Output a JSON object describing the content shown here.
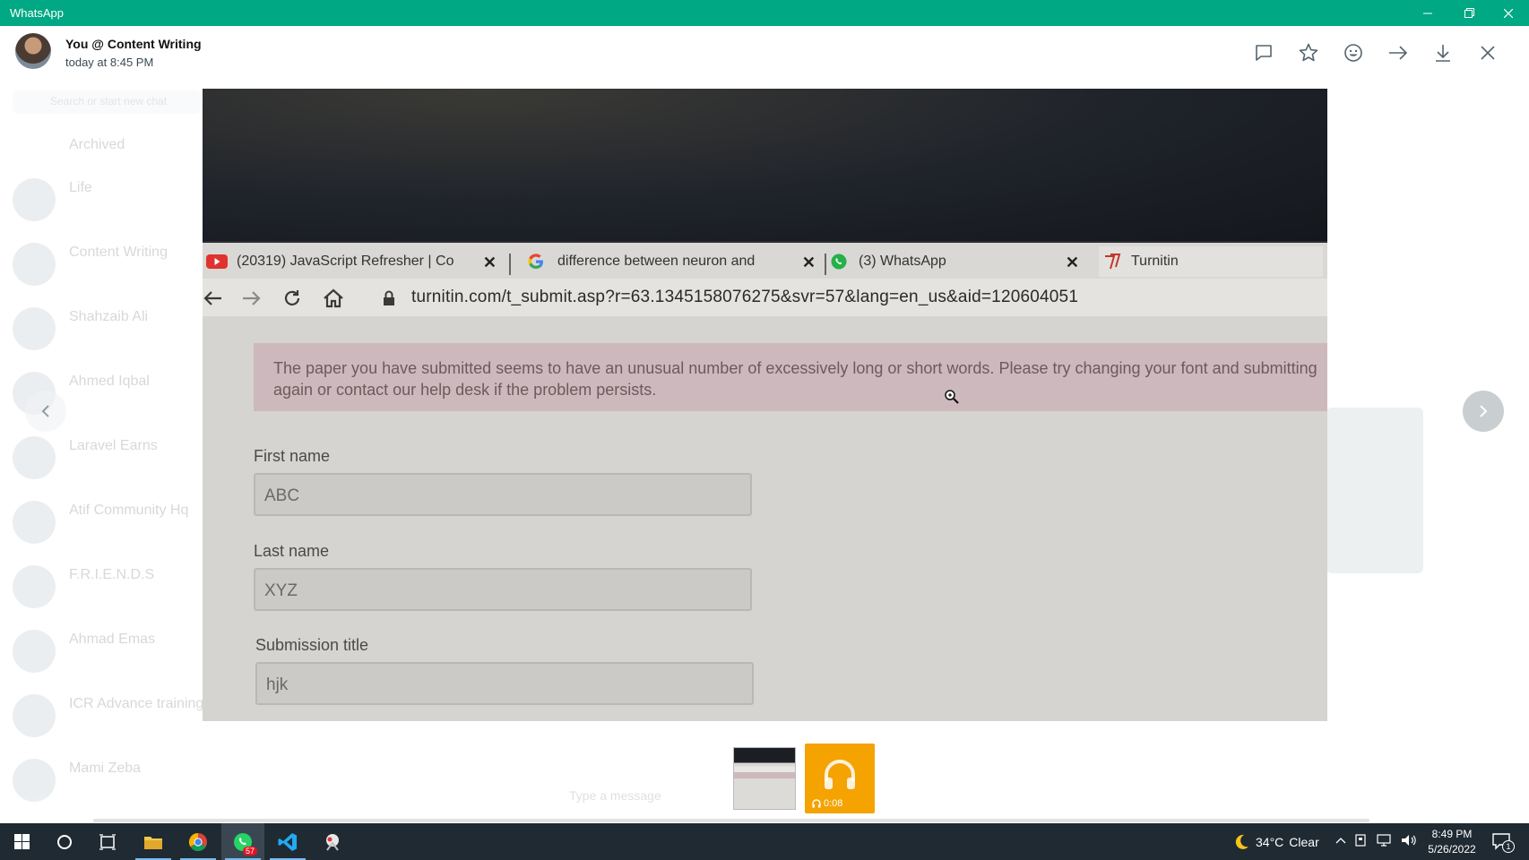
{
  "window": {
    "title": "WhatsApp"
  },
  "viewer": {
    "sender": "You @ Content Writing",
    "time": "today at 8:45 PM",
    "actions": [
      "message-icon",
      "star-icon",
      "emoji-icon",
      "forward-icon",
      "download-icon",
      "close-icon"
    ]
  },
  "background": {
    "search_placeholder": "Search or start new chat",
    "archived": "Archived",
    "chats": [
      {
        "name": "Life",
        "preview": ""
      },
      {
        "name": "Content Writing",
        "preview": ""
      },
      {
        "name": "Shahzaib Ali",
        "preview": ""
      },
      {
        "name": "Ahmed Iqbal",
        "preview": ""
      },
      {
        "name": "Laravel Earns",
        "preview": ""
      },
      {
        "name": "Atif Community Hq",
        "preview": ""
      },
      {
        "name": "F.R.I.E.N.D.S",
        "preview": ""
      },
      {
        "name": "Ahmad Emas",
        "preview": ""
      },
      {
        "name": "ICR Advance training",
        "preview": ""
      },
      {
        "name": "Mami Zeba",
        "preview": ""
      }
    ],
    "caption": "",
    "input_placeholder": "Type a message"
  },
  "photo": {
    "tabs": [
      {
        "label": "(20319) JavaScript Refresher | Co",
        "icon": "youtube-icon"
      },
      {
        "label": "difference between neuron and",
        "icon": "google-icon"
      },
      {
        "label": "(3) WhatsApp",
        "icon": "whatsapp-icon"
      },
      {
        "label": "Turnitin",
        "icon": "turnitin-icon"
      }
    ],
    "url": "turnitin.com/t_submit.asp?r=63.1345158076275&svr=57&lang=en_us&aid=120604051",
    "alert": "The paper you have submitted seems to have an unusual number of excessively long or short words. Please try changing your font and submitting again or contact our help desk if the problem persists.",
    "fields": [
      {
        "label": "First name",
        "value": "ABC"
      },
      {
        "label": "Last name",
        "value": "XYZ"
      },
      {
        "label": "Submission title",
        "value": "hjk"
      }
    ]
  },
  "thumbnails": {
    "audio_duration": "0:08"
  },
  "taskbar": {
    "whatsapp_badge": "57",
    "temperature": "34°C",
    "weather": "Clear",
    "time": "8:49 PM",
    "date": "5/26/2022",
    "notifications": "1"
  },
  "colors": {
    "accent": "#00a884",
    "taskbar": "#1f2a33",
    "audio_thumb": "#f4a300"
  }
}
